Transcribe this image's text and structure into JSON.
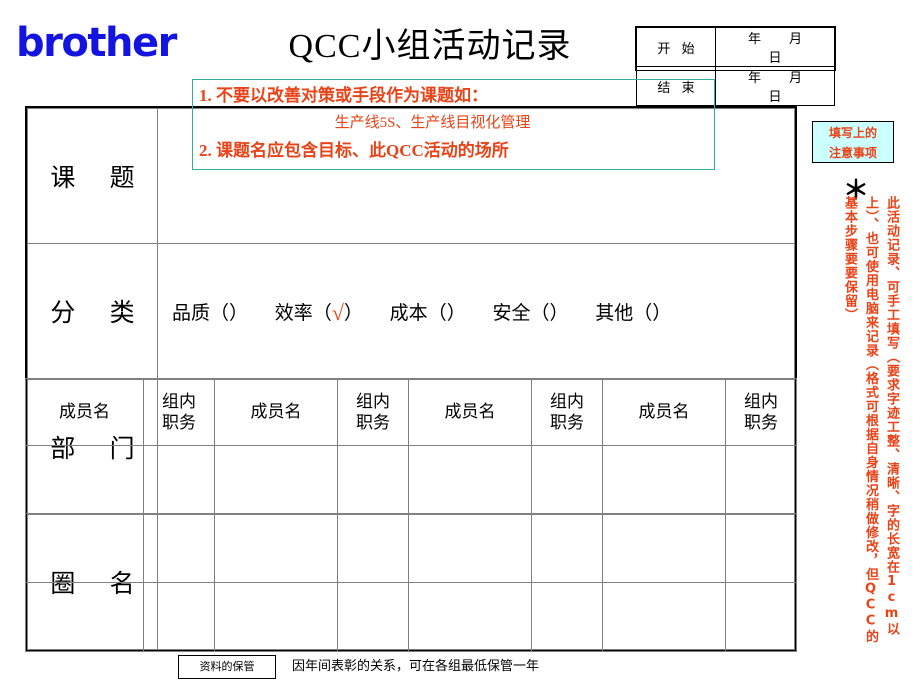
{
  "brand": {
    "logo_text": "brother"
  },
  "header": {
    "title": "QCC小组活动记录"
  },
  "date_table": {
    "rows": [
      {
        "label": "开 始",
        "year": "年",
        "month": "月",
        "day": "日"
      },
      {
        "label": "结 束",
        "year": "年",
        "month": "月",
        "day": "日"
      }
    ]
  },
  "topic_hint": {
    "line1": "1. 不要以改善对策或手段作为课题如：",
    "line2": "生产线5S、生产线目视化管理",
    "line3": "2. 课题名应包含目标、此QCC活动的场所",
    "border_color": "#34aca2",
    "text_color": "#e8441a"
  },
  "form": {
    "labels": {
      "topic": "课 题",
      "category": "分 类",
      "department": "部 门",
      "circle_name": "圈 名"
    },
    "classification": {
      "options": [
        {
          "name": "品质",
          "mark": ""
        },
        {
          "name": "效率",
          "mark": "√"
        },
        {
          "name": "成本",
          "mark": ""
        },
        {
          "name": "安全",
          "mark": ""
        },
        {
          "name": "其他",
          "mark": ""
        }
      ],
      "paren_open": "（",
      "paren_close": "）",
      "mark_color": "#e8441a"
    },
    "member_headers": [
      {
        "l1": "成员名",
        "l2": ""
      },
      {
        "l1": "组内",
        "l2": "职务"
      },
      {
        "l1": "成员名",
        "l2": ""
      },
      {
        "l1": "组内",
        "l2": "职务"
      },
      {
        "l1": "成员名",
        "l2": ""
      },
      {
        "l1": "组内",
        "l2": "职务"
      },
      {
        "l1": "成员名",
        "l2": ""
      },
      {
        "l1": "组内",
        "l2": "职务"
      }
    ],
    "blank_row_count": 3
  },
  "side_note": {
    "box_title_line1": "填写上的",
    "box_title_line2": "注意事项",
    "box_bg": "#ccffff",
    "star": "＊",
    "vertical_text": "此活动记录、可手工填写（要求字迹工整、清晰、字的长宽在1cm以上）、也可使用电脑来记录（格式可根据自身情况稍做修改，但QCC的基本步骤要要保留）",
    "text_color": "#e8441a"
  },
  "footer": {
    "tag": "资料的保管",
    "text": "因年间表彰的关系，可在各组最低保管一年"
  }
}
